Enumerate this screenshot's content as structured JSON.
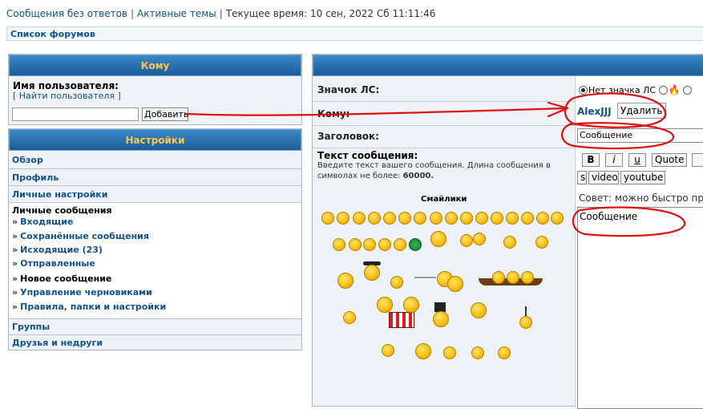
{
  "topnav": {
    "unanswered": "Сообщения без ответов",
    "active": "Активные темы",
    "time_label": "Текущее время: 10 сен, 2022 Сб 11:11:46",
    "sep": "|"
  },
  "forum_list": "Список форумов",
  "to_panel": {
    "title": "Кому",
    "username_label": "Имя пользователя:",
    "find_user": "[ Найти пользователя ]",
    "input_value": "",
    "add_button": "Добавить"
  },
  "settings_panel": {
    "title": "Настройки",
    "items": [
      {
        "label": "Обзор"
      },
      {
        "label": "Профиль"
      },
      {
        "label": "Личные настройки"
      }
    ],
    "pm_header": "Личные сообщения",
    "pm_items": [
      {
        "label": "Входящие"
      },
      {
        "label": "Сохранённые сообщения"
      },
      {
        "label": "Исходящие (23)"
      },
      {
        "label": "Отправленные"
      },
      {
        "label": "Новое сообщение"
      },
      {
        "label": "Управление черновиками"
      },
      {
        "label": "Правила, папки и настройки"
      }
    ],
    "bottom_items": [
      {
        "label": "Группы"
      },
      {
        "label": "Друзья и недруги"
      }
    ]
  },
  "compose": {
    "icon_label": "Значок ЛС:",
    "no_icon": "Нет значка ЛС",
    "to_label": "Кому:",
    "recipient": "AlexJJJ",
    "delete_button": "Удалить",
    "subject_label": "Заголовок:",
    "subject_value": "Сообщение",
    "msg_title": "Текст сообщения:",
    "msg_desc": "Введите текст вашего сообщения. Длина сообщения в символах не более:",
    "msg_limit": "60000.",
    "smiles_title": "Смайлики",
    "format_buttons": {
      "b": "B",
      "i": "i",
      "u": "u",
      "quote": "Quote",
      "s": "s",
      "video": "video",
      "youtube": "youtube"
    },
    "hint": "Совет: можно быстро прим",
    "message_value": "Сообщение"
  },
  "colors": {
    "link": "#105289",
    "header_gradient_top": "#3a88c8",
    "header_text": "#ffc44a",
    "annotation_red": "#e01010"
  }
}
